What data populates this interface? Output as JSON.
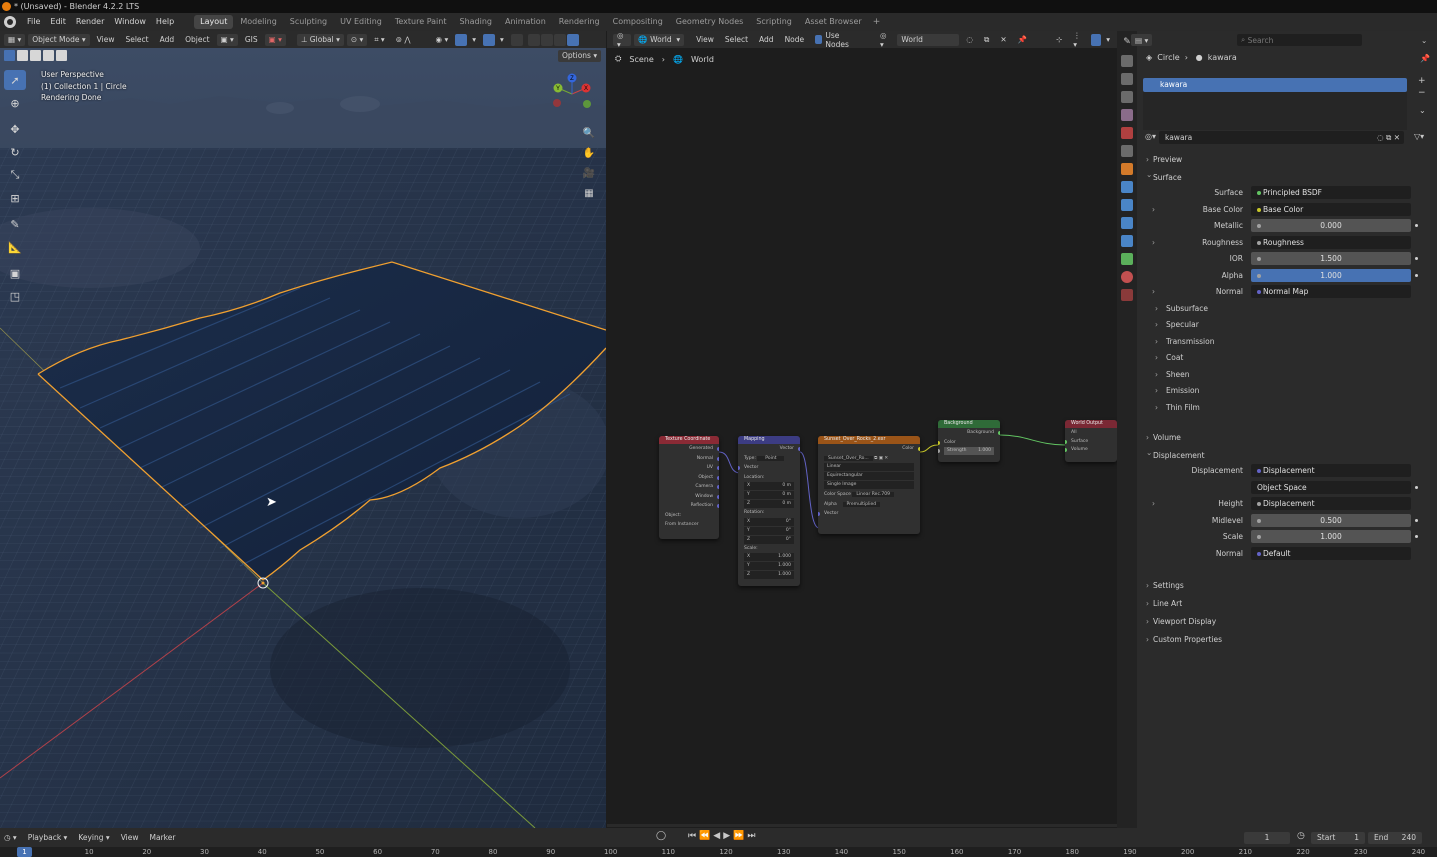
{
  "window_title": "* (Unsaved) - Blender 4.2.2 LTS",
  "menu": [
    "File",
    "Edit",
    "Render",
    "Window",
    "Help"
  ],
  "workspaces": [
    "Layout",
    "Modeling",
    "Sculpting",
    "UV Editing",
    "Texture Paint",
    "Shading",
    "Animation",
    "Rendering",
    "Compositing",
    "Geometry Nodes",
    "Scripting",
    "Asset Browser"
  ],
  "active_workspace": "Layout",
  "viewport": {
    "mode": "Object Mode",
    "menu": [
      "View",
      "Select",
      "Add",
      "Object"
    ],
    "gis": "GIS",
    "orientation": "Global",
    "options": "Options",
    "info_lines": [
      "User Perspective",
      "(1) Collection 1 | Circle",
      "Rendering Done"
    ],
    "axis_labels": [
      "X",
      "Y",
      "Z"
    ]
  },
  "node_editor": {
    "world_type": "World",
    "menu": [
      "View",
      "Select",
      "Add",
      "Node"
    ],
    "use_nodes_label": "Use Nodes",
    "world_name": "World",
    "breadcrumb": [
      "Scene",
      "World"
    ],
    "nodes": {
      "texcoord": {
        "title": "Texture Coordinate",
        "outputs": [
          "Generated",
          "Normal",
          "UV",
          "Object",
          "Camera",
          "Window",
          "Reflection"
        ],
        "object_label": "Object:",
        "from_instancer": "From Instancer"
      },
      "mapping": {
        "title": "Mapping",
        "output": "Vector",
        "type_label": "Type:",
        "type_value": "Point",
        "vector_label": "Vector",
        "location_label": "Location:",
        "location": [
          "0 m",
          "0 m",
          "0 m"
        ],
        "rotation_label": "Rotation:",
        "rotation": [
          "0°",
          "0°",
          "0°"
        ],
        "scale_label": "Scale:",
        "scale": [
          "1.000",
          "1.000",
          "1.000"
        ],
        "axes": [
          "X",
          "Y",
          "Z"
        ]
      },
      "envtex": {
        "title": "Sunset_Over_Rocks_2.exr",
        "output": "Color",
        "image": "Sunset_Over_Ro...",
        "rows": [
          "Linear",
          "Equirectangular",
          "Single Image"
        ],
        "color_space_label": "Color Space",
        "color_space": "Linear Rec.709",
        "alpha_label": "Alpha",
        "alpha": "Premultiplied",
        "vector": "Vector"
      },
      "background": {
        "title": "Background",
        "output": "Background",
        "color": "Color",
        "strength_label": "Strength",
        "strength": "1.000"
      },
      "world_output": {
        "title": "World Output",
        "target": "All",
        "inputs": [
          "Surface",
          "Volume"
        ]
      }
    }
  },
  "properties": {
    "breadcrumb": [
      "Circle",
      "kawara"
    ],
    "search_placeholder": "Search",
    "material_slot": "kawara",
    "material_name": "kawara",
    "panels": {
      "preview": "Preview",
      "surface": "Surface",
      "volume": "Volume",
      "displacement": "Displacement",
      "settings": "Settings",
      "line_art": "Line Art",
      "viewport_display": "Viewport Display",
      "custom_properties": "Custom Properties"
    },
    "surface_rows": [
      {
        "label": "Surface",
        "value": "Principled BSDF",
        "kind": "link",
        "dot": "#62c462"
      },
      {
        "label": "Base Color",
        "value": "Base Color",
        "kind": "link",
        "dot": "#c7c729",
        "expand": true
      },
      {
        "label": "Metallic",
        "value": "0.000",
        "kind": "num",
        "dot": "#a1a1a1"
      },
      {
        "label": "Roughness",
        "value": "Roughness",
        "kind": "link",
        "dot": "#a1a1a1",
        "expand": true
      },
      {
        "label": "IOR",
        "value": "1.500",
        "kind": "num",
        "dot": "#a1a1a1"
      },
      {
        "label": "Alpha",
        "value": "1.000",
        "kind": "full",
        "dot": "#a1a1a1"
      },
      {
        "label": "Normal",
        "value": "Normal Map",
        "kind": "link",
        "dot": "#6363c7",
        "expand": true
      }
    ],
    "surface_subpanels": [
      "Subsurface",
      "Specular",
      "Transmission",
      "Coat",
      "Sheen",
      "Emission",
      "Thin Film"
    ],
    "displacement_rows": [
      {
        "label": "Displacement",
        "value": "Displacement",
        "kind": "link",
        "dot": "#6363c7"
      },
      {
        "label": "",
        "value": "Object Space",
        "kind": "dark"
      },
      {
        "label": "Height",
        "value": "Displacement",
        "kind": "link",
        "dot": "#a1a1a1",
        "expand": true
      },
      {
        "label": "Midlevel",
        "value": "0.500",
        "kind": "num",
        "dot": "#a1a1a1"
      },
      {
        "label": "Scale",
        "value": "1.000",
        "kind": "num",
        "dot": "#a1a1a1"
      },
      {
        "label": "Normal",
        "value": "Default",
        "kind": "link",
        "dot": "#6363c7"
      }
    ]
  },
  "timeline": {
    "menu": [
      "Playback",
      "Keying",
      "View",
      "Marker"
    ],
    "current_frame": "1",
    "start_label": "Start",
    "start": "1",
    "end_label": "End",
    "end": "240",
    "ruler": [
      "1",
      "10",
      "20",
      "30",
      "40",
      "50",
      "60",
      "70",
      "80",
      "90",
      "100",
      "110",
      "120",
      "130",
      "140",
      "150",
      "160",
      "170",
      "180",
      "190",
      "200",
      "210",
      "220",
      "230",
      "240"
    ]
  },
  "colors": {
    "accent": "#4772b3",
    "selection_outline": "#f0a030",
    "bg": "#1d1d1d",
    "panel": "#2b2b2b"
  }
}
